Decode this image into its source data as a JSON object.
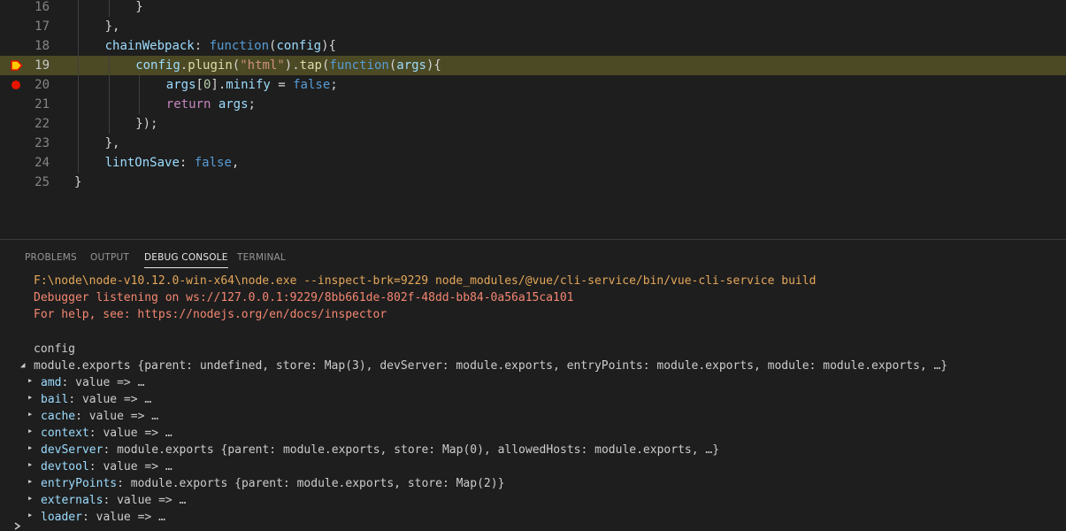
{
  "editor": {
    "lines": [
      {
        "num": "16",
        "indent": 2,
        "tokens": [
          {
            "t": "}",
            "c": "pun"
          }
        ]
      },
      {
        "num": "17",
        "indent": 1,
        "tokens": [
          {
            "t": "},",
            "c": "pun"
          }
        ]
      },
      {
        "num": "18",
        "indent": 1,
        "tokens": [
          {
            "t": "chainWebpack",
            "c": "prop"
          },
          {
            "t": ": ",
            "c": "pun"
          },
          {
            "t": "function",
            "c": "kw"
          },
          {
            "t": "(",
            "c": "pun"
          },
          {
            "t": "config",
            "c": "prop"
          },
          {
            "t": "){",
            "c": "pun"
          }
        ]
      },
      {
        "num": "19",
        "indent": 2,
        "current": true,
        "breakpoint": "current",
        "tokens": [
          {
            "t": "config",
            "c": "prop"
          },
          {
            "t": ".",
            "c": "pun"
          },
          {
            "t": "plugin",
            "c": "fn"
          },
          {
            "t": "(",
            "c": "pun"
          },
          {
            "t": "\"html\"",
            "c": "str"
          },
          {
            "t": ").",
            "c": "pun"
          },
          {
            "t": "tap",
            "c": "fn"
          },
          {
            "t": "(",
            "c": "pun"
          },
          {
            "t": "function",
            "c": "kw"
          },
          {
            "t": "(",
            "c": "pun"
          },
          {
            "t": "args",
            "c": "prop"
          },
          {
            "t": "){",
            "c": "pun"
          }
        ]
      },
      {
        "num": "20",
        "indent": 3,
        "breakpoint": "normal",
        "tokens": [
          {
            "t": "args",
            "c": "prop"
          },
          {
            "t": "[",
            "c": "pun"
          },
          {
            "t": "0",
            "c": "num"
          },
          {
            "t": "].",
            "c": "pun"
          },
          {
            "t": "minify",
            "c": "prop"
          },
          {
            "t": " = ",
            "c": "pun"
          },
          {
            "t": "false",
            "c": "kw"
          },
          {
            "t": ";",
            "c": "pun"
          }
        ]
      },
      {
        "num": "21",
        "indent": 3,
        "tokens": [
          {
            "t": "return",
            "c": "ctl"
          },
          {
            "t": " ",
            "c": "pun"
          },
          {
            "t": "args",
            "c": "prop"
          },
          {
            "t": ";",
            "c": "pun"
          }
        ]
      },
      {
        "num": "22",
        "indent": 2,
        "tokens": [
          {
            "t": "});",
            "c": "pun"
          }
        ]
      },
      {
        "num": "23",
        "indent": 1,
        "tokens": [
          {
            "t": "},",
            "c": "pun"
          }
        ]
      },
      {
        "num": "24",
        "indent": 1,
        "tokens": [
          {
            "t": "lintOnSave",
            "c": "prop"
          },
          {
            "t": ": ",
            "c": "pun"
          },
          {
            "t": "false",
            "c": "kw"
          },
          {
            "t": ",",
            "c": "pun"
          }
        ]
      },
      {
        "num": "25",
        "indent": 0,
        "tokens": [
          {
            "t": "}",
            "c": "pun"
          }
        ]
      }
    ]
  },
  "panel": {
    "tabs": [
      {
        "label": "PROBLEMS",
        "active": false
      },
      {
        "label": "OUTPUT",
        "active": false
      },
      {
        "label": "DEBUG CONSOLE",
        "active": true
      },
      {
        "label": "TERMINAL",
        "active": false
      }
    ]
  },
  "console": {
    "command": "F:\\node\\node-v10.12.0-win-x64\\node.exe --inspect-brk=9229 node_modules/@vue/cli-service/bin/vue-cli-service build",
    "listening": "Debugger listening on ws://127.0.0.1:9229/8bb661de-802f-48dd-bb84-0a56a15ca101",
    "help": "For help, see: https://nodejs.org/en/docs/inspector",
    "label": "config",
    "root": "module.exports {parent: undefined, store: Map(3), devServer: module.exports, entryPoints: module.exports, module: module.exports, …}",
    "children": [
      {
        "key": "amd",
        "value": "value => …"
      },
      {
        "key": "bail",
        "value": "value => …"
      },
      {
        "key": "cache",
        "value": "value => …"
      },
      {
        "key": "context",
        "value": "value => …"
      },
      {
        "key": "devServer",
        "value": "module.exports {parent: module.exports, store: Map(0), allowedHosts: module.exports, …}"
      },
      {
        "key": "devtool",
        "value": "value => …"
      },
      {
        "key": "entryPoints",
        "value": "module.exports {parent: module.exports, store: Map(2)}"
      },
      {
        "key": "externals",
        "value": "value => …"
      },
      {
        "key": "loader",
        "value": "value => …"
      }
    ]
  }
}
